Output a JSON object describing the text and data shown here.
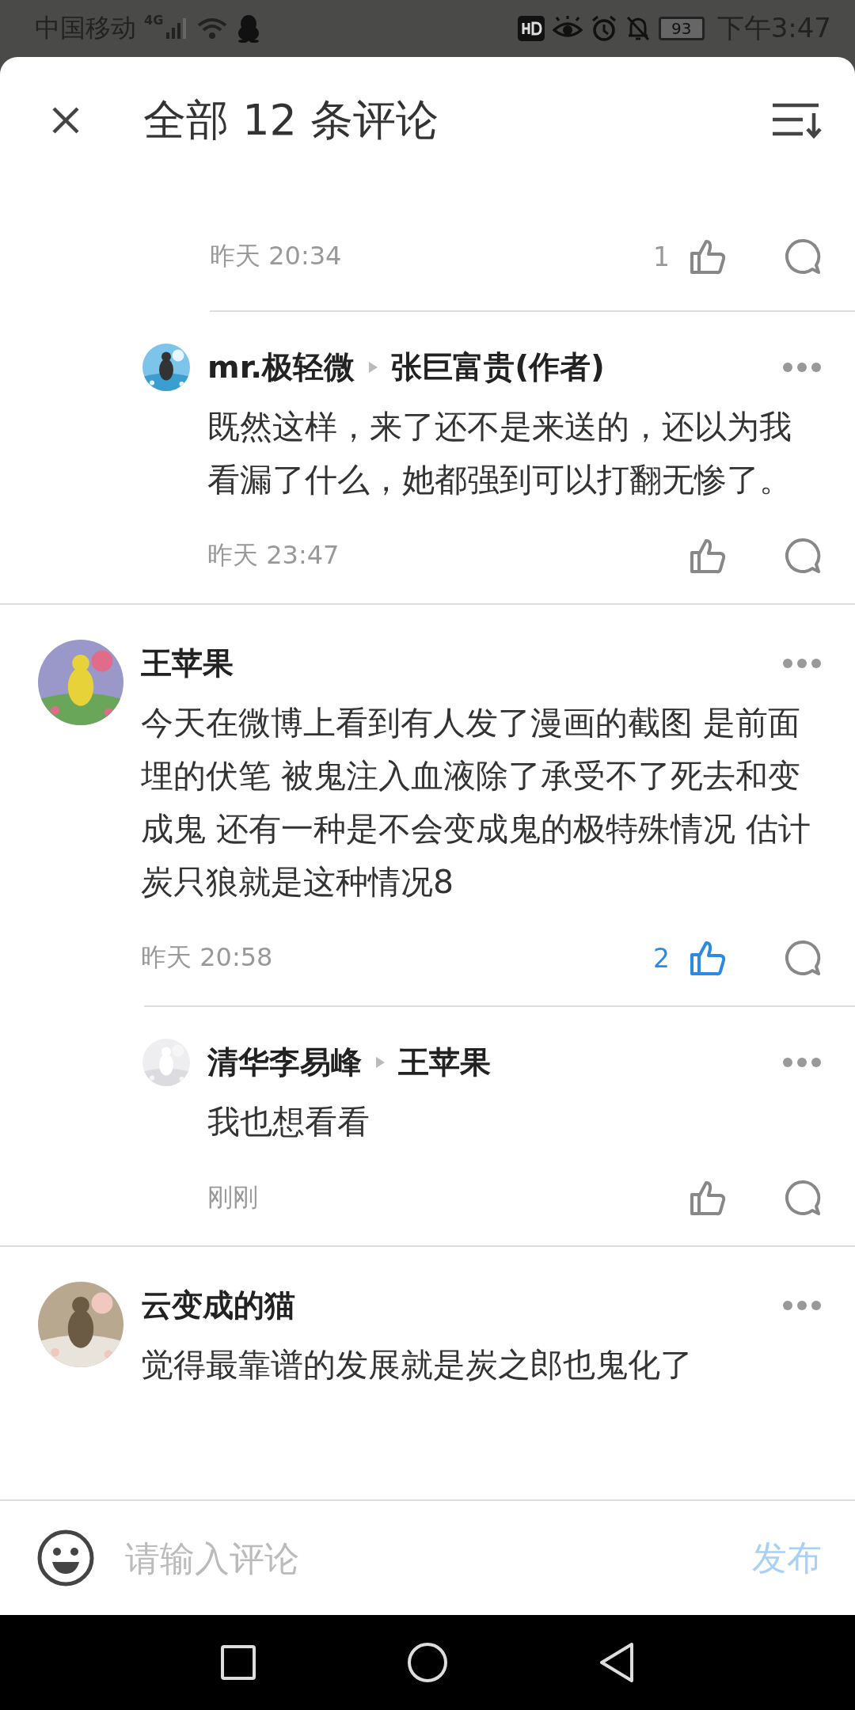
{
  "status_bar": {
    "carrier": "中国移动",
    "network": "4G",
    "battery": "93",
    "time": "下午3:47"
  },
  "header": {
    "title": "全部 12 条评论"
  },
  "comments": [
    {
      "kind": "tail",
      "time": "昨天 20:34",
      "likes": "1",
      "liked": false
    },
    {
      "kind": "reply",
      "author": "mr.极轻微",
      "reply_to": "张巨富贵(作者)",
      "text": "既然这样，来了还不是来送的，还以为我看漏了什么，她都强到可以打翻无惨了。",
      "time": "昨天 23:47",
      "liked": false
    },
    {
      "kind": "comment",
      "author": "王苹果",
      "text": "今天在微博上看到有人发了漫画的截图 是前面埋的伏笔 被鬼注入血液除了承受不了死去和变成鬼 还有一种是不会变成鬼的极特殊情况 估计炭只狼就是这种情况8",
      "time": "昨天 20:58",
      "likes": "2",
      "liked": true
    },
    {
      "kind": "reply",
      "author": "清华李易峰",
      "reply_to": "王苹果",
      "text": "我也想看看",
      "time": "刚刚",
      "liked": false
    },
    {
      "kind": "comment",
      "author": "云变成的猫",
      "text": "觉得最靠谱的发展就是炭之郎也鬼化了"
    }
  ],
  "input": {
    "placeholder": "请输入评论",
    "send": "发布"
  }
}
